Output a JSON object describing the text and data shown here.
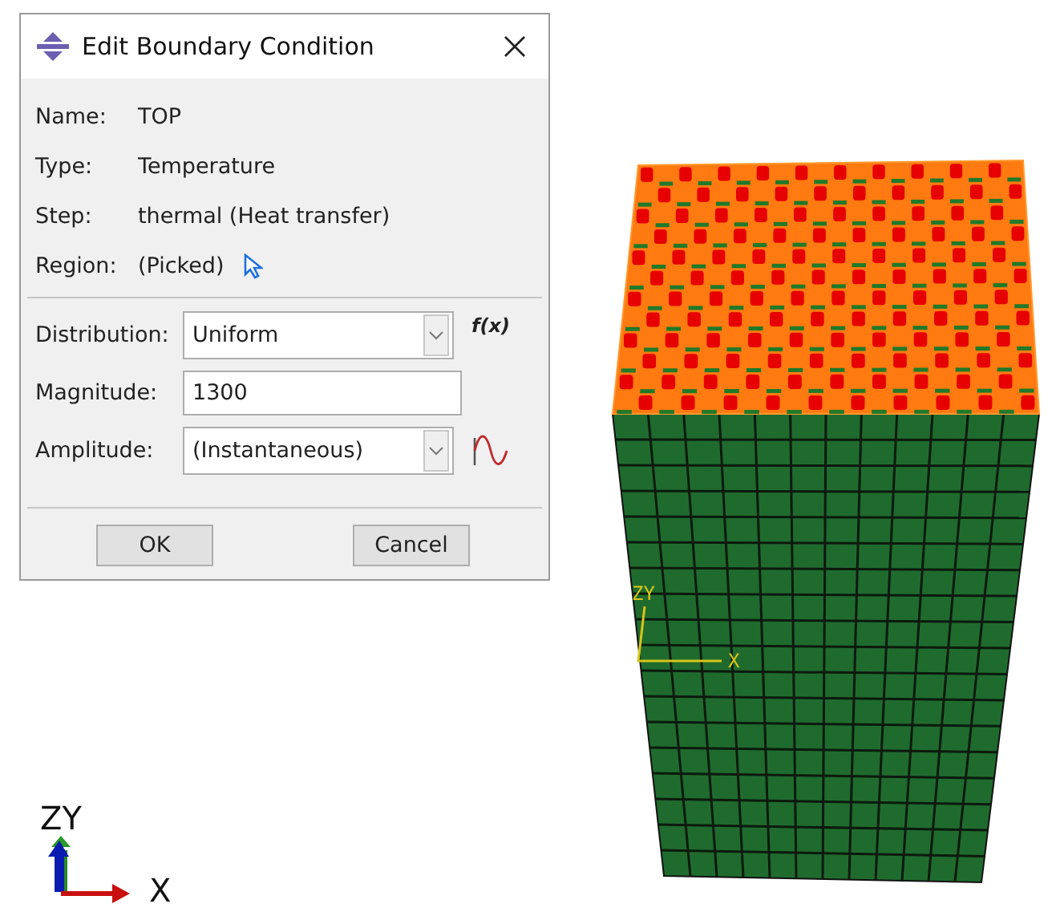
{
  "dialog": {
    "title": "Edit Boundary Condition",
    "info": [
      {
        "label": "Name:",
        "value": "TOP"
      },
      {
        "label": "Type:",
        "value": "Temperature"
      },
      {
        "label": "Step:",
        "value": "thermal (Heat transfer)"
      },
      {
        "label": "Region:",
        "value": "(Picked)",
        "pick": true
      }
    ],
    "fields": [
      {
        "kind": "dropdown",
        "label": "Distribution:",
        "value": "Uniform",
        "side": {
          "kind": "fx",
          "text": "f(x)"
        }
      },
      {
        "kind": "text",
        "label": "Magnitude:",
        "value": "1300"
      },
      {
        "kind": "dropdown",
        "label": "Amplitude:",
        "value": "(Instantaneous)",
        "side": {
          "kind": "wave"
        }
      }
    ],
    "buttons": [
      "OK",
      "Cancel"
    ]
  },
  "viewport": {
    "model_triad": {
      "zy": "ZY",
      "x": "X"
    },
    "global_triad": {
      "zy": "ZY",
      "x": "X"
    }
  }
}
